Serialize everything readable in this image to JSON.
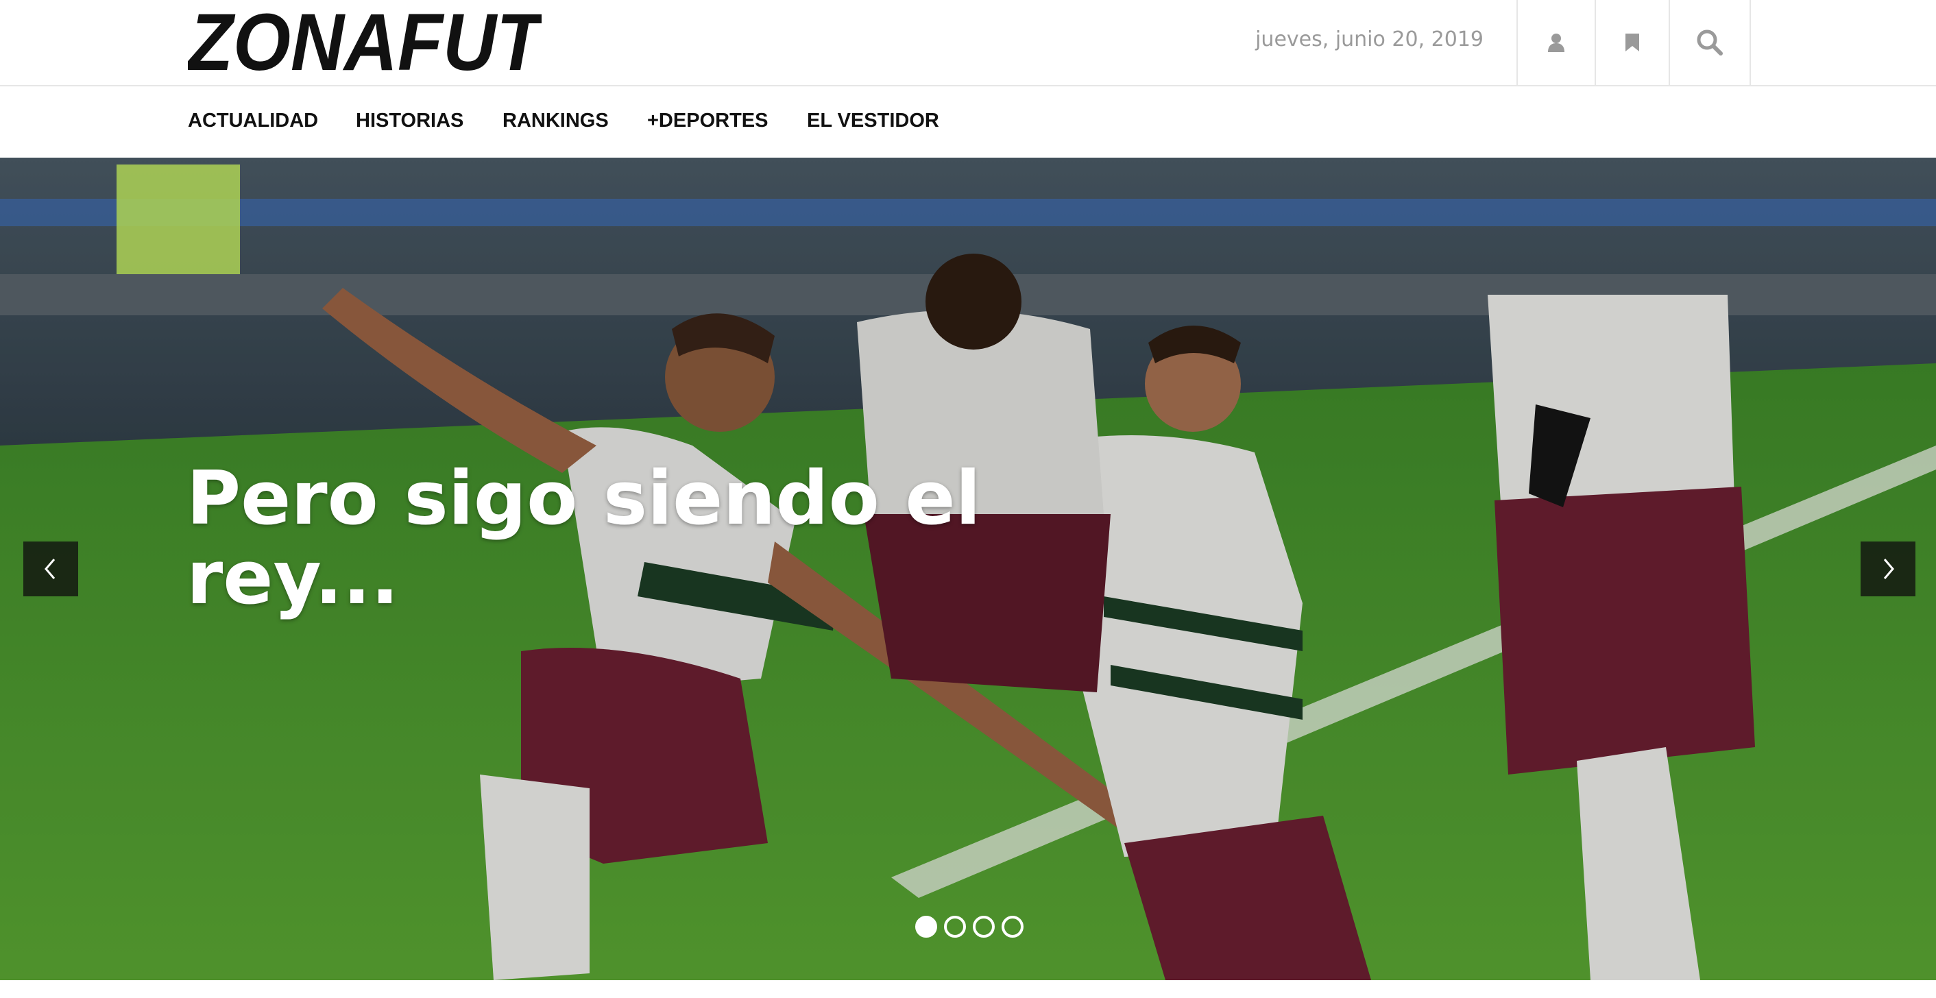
{
  "brand": {
    "logo_text": "ZONAFUT"
  },
  "header": {
    "date": "jueves, junio 20, 2019",
    "icons": [
      "user-icon",
      "bookmark-icon",
      "search-icon"
    ]
  },
  "nav": {
    "items": [
      {
        "label": "ACTUALIDAD"
      },
      {
        "label": "HISTORIAS"
      },
      {
        "label": "RANKINGS"
      },
      {
        "label": "+DEPORTES"
      },
      {
        "label": "EL VESTIDOR"
      }
    ]
  },
  "hero": {
    "title": "Pero sigo siendo el rey...",
    "slides_count": 4,
    "active_slide": 1,
    "prev_icon": "chevron-left-icon",
    "next_icon": "chevron-right-icon"
  },
  "colors": {
    "text_dark": "#111111",
    "date_gray": "#9a9a9a",
    "border": "#e6e6e6",
    "pitch_green": "#4f9a2e",
    "kit_white": "#ecece9",
    "kit_maroon": "#6d1f33"
  }
}
